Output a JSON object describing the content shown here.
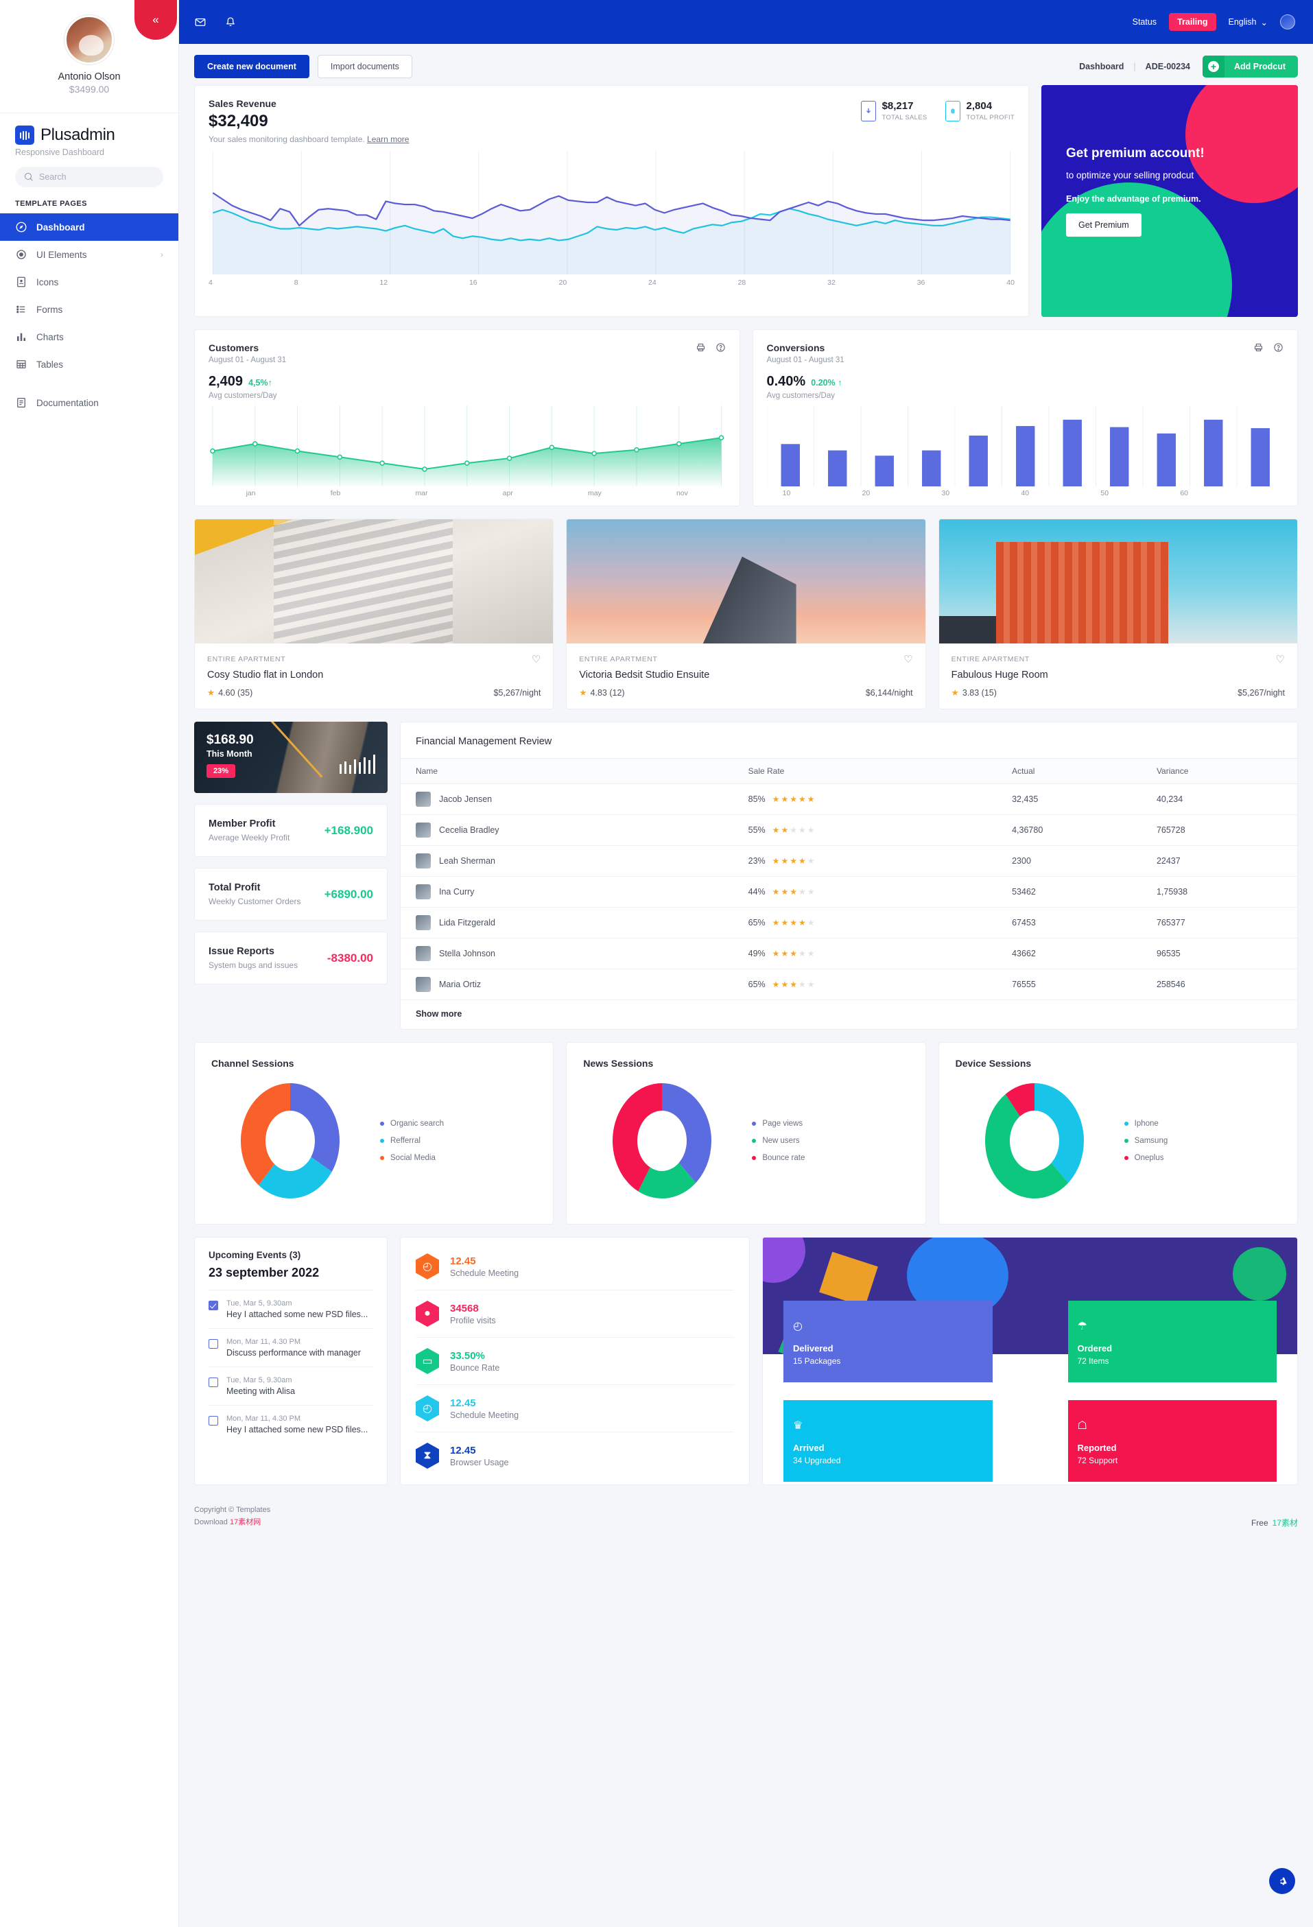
{
  "sidebar": {
    "profile": {
      "name": "Antonio Olson",
      "amount": "$3499.00"
    },
    "brand": {
      "name": "Plusadmin",
      "tagline": "Responsive Dashboard"
    },
    "search_placeholder": "Search",
    "nav_title": "TEMPLATE PAGES",
    "items": [
      {
        "label": "Dashboard",
        "icon": "compass-icon",
        "active": true
      },
      {
        "label": "UI Elements",
        "icon": "target-icon",
        "chevron": "›"
      },
      {
        "label": "Icons",
        "icon": "contact-card-icon"
      },
      {
        "label": "Forms",
        "icon": "list-icon"
      },
      {
        "label": "Charts",
        "icon": "bar-chart-icon"
      },
      {
        "label": "Tables",
        "icon": "table-icon"
      },
      {
        "label": "Documentation",
        "icon": "document-icon"
      }
    ]
  },
  "topbar": {
    "mail_icon": "envelope-icon",
    "bell_icon": "bell-icon",
    "status": "Status",
    "trailing_badge": "Trailing",
    "language": "English",
    "chevron": "⌄"
  },
  "actionbar": {
    "create_label": "Create new document",
    "import_label": "Import documents",
    "breadcrumb_page": "Dashboard",
    "breadcrumb_sep": "|",
    "breadcrumb_code": "ADE-00234",
    "add_label": "Add Prodcut",
    "add_plus": "+"
  },
  "sales": {
    "title": "Sales Revenue",
    "amount": "$32,409",
    "subtitle": "Your sales monitoring dashboard template.",
    "link": "Learn more",
    "stats": [
      {
        "value": "$8,217",
        "label": "TOTAL SALES",
        "color": "#5b6ce0",
        "icon": "download-phone-icon"
      },
      {
        "value": "2,804",
        "label": "TOTAL PROFIT",
        "color": "#18c5e8",
        "icon": "profit-phone-icon"
      }
    ]
  },
  "premium": {
    "title": "Get premium account!",
    "subtitle": "to optimize your selling prodcut",
    "note": "Enjoy the advantage of premium.",
    "button": "Get Premium"
  },
  "customers": {
    "title": "Customers",
    "range": "August 01 - August 31",
    "value": "2,409",
    "delta": "4,5%",
    "arrow": "↑",
    "caption": "Avg customers/Day",
    "print_icon": "printer-icon",
    "help_icon": "help-circle-icon"
  },
  "conversions": {
    "title": "Conversions",
    "range": "August 01 - August 31",
    "value": "0.40%",
    "delta": "0.20%",
    "arrow": "↑",
    "caption": "Avg customers/Day",
    "print_icon": "printer-icon",
    "help_icon": "help-circle-icon"
  },
  "properties": [
    {
      "tag": "ENTIRE APARTMENT",
      "name": "Cosy Studio flat in London",
      "rating": "4.60 (35)",
      "price": "$5,267/night",
      "heart": "♡",
      "star": "★"
    },
    {
      "tag": "ENTIRE APARTMENT",
      "name": "Victoria Bedsit Studio Ensuite",
      "rating": "4.83 (12)",
      "price": "$6,144/night",
      "heart": "♡",
      "star": "★"
    },
    {
      "tag": "ENTIRE APARTMENT",
      "name": "Fabulous Huge Room",
      "rating": "3.83 (15)",
      "price": "$5,267/night",
      "heart": "♡",
      "star": "★"
    }
  ],
  "month_card": {
    "amount": "$168.90",
    "label": "This Month",
    "badge": "23%"
  },
  "kpis": [
    {
      "name": "Member Profit",
      "sub": "Average Weekly Profit",
      "value": "+168.900",
      "negative": false
    },
    {
      "name": "Total Profit",
      "sub": "Weekly Customer Orders",
      "value": "+6890.00",
      "negative": false
    },
    {
      "name": "Issue Reports",
      "sub": "System bugs and issues",
      "value": "-8380.00",
      "negative": true
    }
  ],
  "financial": {
    "title": "Financial Management Review",
    "columns": [
      "Name",
      "Sale Rate",
      "Actual",
      "Variance"
    ],
    "rows": [
      {
        "name": "Jacob Jensen",
        "rate": "85%",
        "stars": 5,
        "actual": "32,435",
        "variance": "40,234"
      },
      {
        "name": "Cecelia Bradley",
        "rate": "55%",
        "stars": 2,
        "actual": "4,36780",
        "variance": "765728"
      },
      {
        "name": "Leah Sherman",
        "rate": "23%",
        "stars": 4,
        "actual": "2300",
        "variance": "22437"
      },
      {
        "name": "Ina Curry",
        "rate": "44%",
        "stars": 3,
        "actual": "53462",
        "variance": "1,75938"
      },
      {
        "name": "Lida Fitzgerald",
        "rate": "65%",
        "stars": 4,
        "actual": "67453",
        "variance": "765377"
      },
      {
        "name": "Stella Johnson",
        "rate": "49%",
        "stars": 3,
        "actual": "43662",
        "variance": "96535"
      },
      {
        "name": "Maria Ortiz",
        "rate": "65%",
        "stars": 3,
        "actual": "76555",
        "variance": "258546"
      }
    ],
    "show_more": "Show more"
  },
  "events": {
    "title": "Upcoming Events (3)",
    "date": "23 september 2022",
    "items": [
      {
        "time": "Tue, Mar 5, 9.30am",
        "text": "Hey I attached some new PSD files...",
        "checked": true
      },
      {
        "time": "Mon, Mar 11, 4.30 PM",
        "text": "Discuss performance with manager",
        "checked": false
      },
      {
        "time": "Tue, Mar 5, 9.30am",
        "text": "Meeting with Alisa",
        "checked": false
      },
      {
        "time": "Mon, Mar 11, 4.30 PM",
        "text": "Hey I attached some new PSD files...",
        "checked": false
      }
    ]
  },
  "hex_stats": [
    {
      "value": "12.45",
      "label": "Schedule Meeting",
      "color": "#fb6a21",
      "icon": "clock-icon",
      "glyph": "◴"
    },
    {
      "value": "34568",
      "label": "Profile visits",
      "color": "#f4245e",
      "icon": "user-icon",
      "glyph": "●"
    },
    {
      "value": "33.50%",
      "label": "Bounce Rate",
      "color": "#12c98a",
      "icon": "laptop-icon",
      "glyph": "▭"
    },
    {
      "value": "12.45",
      "label": "Schedule Meeting",
      "color": "#21c8ec",
      "icon": "clock-icon",
      "glyph": "◴"
    },
    {
      "value": "12.45",
      "label": "Browser Usage",
      "color": "#0f42bf",
      "icon": "hourglass-icon",
      "glyph": "⧗"
    }
  ],
  "tiles": [
    {
      "name": "Delivered",
      "sub": "15 Packages",
      "color": "#5b6ce0",
      "icon": "clock-icon",
      "glyph": "◴"
    },
    {
      "name": "Ordered",
      "sub": "72 Items",
      "color": "#0ec77e",
      "icon": "shirt-icon",
      "glyph": "☂"
    },
    {
      "name": "Arrived",
      "sub": "34 Upgraded",
      "color": "#07c3ed",
      "icon": "trophy-icon",
      "glyph": "♛"
    },
    {
      "name": "Reported",
      "sub": "72 Support",
      "color": "#f4154f",
      "icon": "board-icon",
      "glyph": "☖"
    }
  ],
  "footer": {
    "copyright": "Copyright © Templates",
    "download_prefix": "Download ",
    "download_link": "17素材网",
    "free_label": "Free",
    "free_link": "17素材",
    "gear_icon": "gear-icon"
  },
  "chart_data": [
    {
      "type": "line",
      "title": "Sales Revenue",
      "id": "sales-revenue",
      "xlabel": "",
      "ylabel": "",
      "xticks": [
        4,
        8,
        12,
        16,
        20,
        24,
        28,
        32,
        36,
        40
      ],
      "xlim": [
        4,
        40
      ],
      "ylim": [
        0,
        100
      ],
      "grid": true,
      "series": [
        {
          "name": "Revenue",
          "color": "#5b5bd6",
          "values": [
            72,
            66,
            60,
            56,
            53,
            50,
            46,
            57,
            54,
            41,
            49,
            56,
            57,
            56,
            55,
            51,
            51,
            47,
            64,
            62,
            61,
            61,
            59,
            55,
            54,
            52,
            50,
            48,
            52,
            57,
            61,
            58,
            55,
            56,
            61,
            66,
            69,
            65,
            64,
            63,
            63,
            68,
            64,
            62,
            60,
            62,
            56,
            53,
            56,
            58,
            60,
            62,
            58,
            55,
            51,
            50,
            48,
            47,
            46,
            54,
            57,
            60,
            63,
            60,
            64,
            62,
            58,
            55,
            53,
            52,
            52,
            50,
            48,
            47,
            46,
            46,
            47,
            48,
            50,
            49,
            48,
            47,
            47,
            46
          ]
        },
        {
          "name": "Profit",
          "color": "#1ecbe1",
          "values": [
            53,
            56,
            53,
            49,
            45,
            43,
            40,
            38,
            38,
            39,
            38,
            37,
            39,
            38,
            39,
            40,
            39,
            38,
            36,
            39,
            41,
            38,
            36,
            34,
            38,
            31,
            29,
            31,
            30,
            28,
            27,
            29,
            27,
            28,
            27,
            29,
            27,
            28,
            31,
            34,
            40,
            38,
            37,
            39,
            38,
            40,
            37,
            39,
            36,
            34,
            38,
            40,
            42,
            41,
            44,
            45,
            48,
            52,
            51,
            54,
            57,
            55,
            52,
            50,
            47,
            45,
            43,
            41,
            43,
            45,
            43,
            46,
            44,
            43,
            42,
            41,
            41,
            43,
            45,
            47,
            49,
            49,
            48,
            47
          ]
        }
      ]
    },
    {
      "type": "area",
      "title": "Customers",
      "id": "customers",
      "subtitle": "August 01 - August 31",
      "value": "2,409",
      "delta": "4,5%",
      "ylabel": "Avg customers/Day",
      "xticks": [
        "jan",
        "feb",
        "mar",
        "apr",
        "may",
        "nov"
      ],
      "categories": [
        "",
        "jan",
        "",
        "feb",
        "",
        "mar",
        "",
        "apr",
        "",
        "may",
        "",
        "nov",
        ""
      ],
      "values": [
        52,
        58,
        52,
        47,
        42,
        37,
        42,
        46,
        55,
        50,
        53,
        58,
        63
      ],
      "color": "#22c98c",
      "grid": true
    },
    {
      "type": "bar",
      "title": "Conversions",
      "id": "conversions",
      "subtitle": "August 01 - August 31",
      "value": "0.40%",
      "delta": "0.20%",
      "ylabel": "Avg customers/Day",
      "xticks": [
        10,
        20,
        30,
        40,
        50,
        60
      ],
      "categories": [
        "10",
        "",
        "20",
        "",
        "30",
        "",
        "40",
        "",
        "50",
        "",
        "60",
        "",
        ""
      ],
      "values": [
        40,
        34,
        29,
        34,
        48,
        57,
        63,
        56,
        50,
        63,
        55
      ],
      "color": "#5b6ce0",
      "ylim": [
        0,
        70
      ],
      "grid": true
    },
    {
      "type": "pie",
      "title": "Channel Sessions",
      "id": "channel-sessions",
      "labels": [
        "Organic search",
        "Refferral",
        "Social Media"
      ],
      "values": [
        34,
        27,
        39
      ],
      "colors": [
        "#5b6ce0",
        "#18c5e8",
        "#f9602a"
      ],
      "legend": "right"
    },
    {
      "type": "pie",
      "title": "News Sessions",
      "id": "news-sessions",
      "labels": [
        "Page views",
        "New users",
        "Bounce rate"
      ],
      "values": [
        38,
        20,
        42
      ],
      "colors": [
        "#5b6ce0",
        "#0ec77e",
        "#f4154f"
      ],
      "legend": "right"
    },
    {
      "type": "pie",
      "title": "Device Sessions",
      "id": "device-sessions",
      "labels": [
        "Iphone",
        "Samsung",
        "Oneplus"
      ],
      "values": [
        38,
        52,
        10
      ],
      "colors": [
        "#18c5e8",
        "#0ec77e",
        "#f4154f"
      ],
      "legend": "right"
    }
  ]
}
